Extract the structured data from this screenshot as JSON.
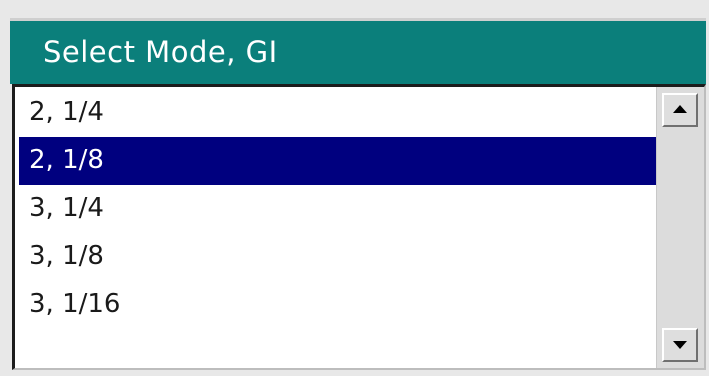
{
  "dialog": {
    "title": "Select Mode, GI"
  },
  "list": {
    "items": [
      {
        "label": "2, 1/4",
        "selected": false
      },
      {
        "label": "2, 1/8",
        "selected": true
      },
      {
        "label": "3, 1/4",
        "selected": false
      },
      {
        "label": "3, 1/8",
        "selected": false
      },
      {
        "label": "3, 1/16",
        "selected": false
      }
    ],
    "selected_label": "2, 1/8"
  },
  "colors": {
    "title_bar": "#0b7f7b",
    "selection": "#00007f",
    "list_background": "#ffffff",
    "scrollbar": "#dcdcdc"
  },
  "icons": {
    "scroll_up": "arrow-up-icon",
    "scroll_down": "arrow-down-icon"
  }
}
